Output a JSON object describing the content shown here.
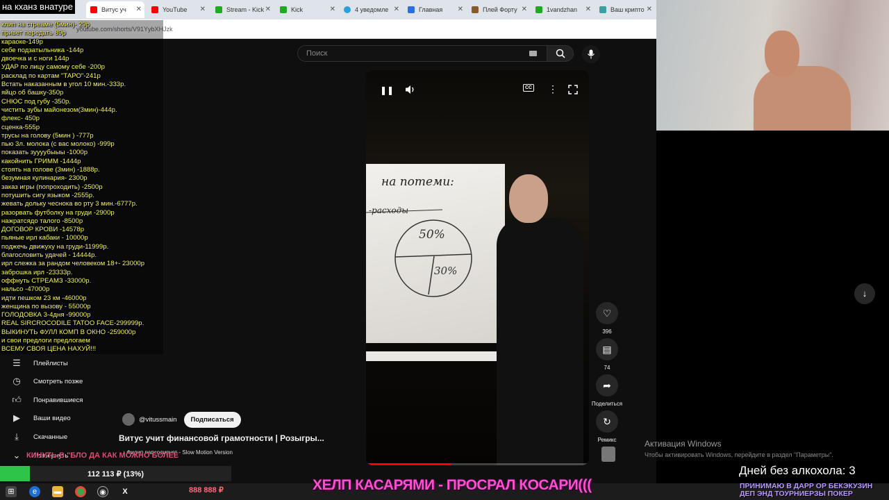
{
  "browser": {
    "tabs": [
      {
        "label": "Витус уч",
        "active": true,
        "color": "#ff0000"
      },
      {
        "label": "YouTube",
        "color": "#ff0000"
      },
      {
        "label": "Stream - Kick",
        "color": "#1faa1f"
      },
      {
        "label": "Kick",
        "color": "#1faa1f"
      },
      {
        "label": "4 уведомле",
        "color": "#2aa0e0"
      },
      {
        "label": "Главная",
        "color": "#2a6ee0"
      },
      {
        "label": "Плей Форту",
        "color": "#8a5a2a"
      },
      {
        "label": "1vandzhan",
        "color": "#1faa1f"
      },
      {
        "label": "Ваш крипто",
        "color": "#3aa0a0"
      }
    ],
    "url": "youtube.com/shorts/V91YybXHJzk"
  },
  "youtube": {
    "search_placeholder": "Поиск",
    "sidebar": [
      {
        "label": "Плейлисты",
        "icon": "playlist-icon"
      },
      {
        "label": "Смотреть позже",
        "icon": "clock-icon"
      },
      {
        "label": "Понравившиеся",
        "icon": "thumbs-up-icon"
      },
      {
        "label": "Ваши видео",
        "icon": "video-icon"
      },
      {
        "label": "Скачанные",
        "icon": "download-icon"
      },
      {
        "label": "Развернуть",
        "icon": "chevron-down-icon"
      }
    ],
    "video": {
      "board_heading": "на потеми:",
      "board_sub": "-расходы",
      "pct1": "50%",
      "pct2": "30%",
      "progress_fraction": 0.38
    },
    "actions": {
      "likes": "396",
      "comments": "74",
      "share": "Поделиться",
      "remix": "Ремикс"
    },
    "channel": "@vitussmain",
    "subscribe": "Подписаться",
    "title": "Витус учит финансовой грамотности  | Розыгры...",
    "music": "Филип рапсодирует - Slow Motion Version"
  },
  "overlay": {
    "title": "на кханз внатуре",
    "prices": [
      "клип на стреаме (5мин)- 29р",
      "привет передать 89р",
      "караоке-149р",
      "себе подзатыльника -144р",
      "двоечка и с ноги 144р",
      "УДАР по лицу самому себе -200р",
      "расклад по картам \"ТАРО\"-241р",
      "Встать наказанным в угол 10 мин.-333р.",
      "яйцо об башку-350р",
      "СНЮС под губу -350р.",
      "чистить зубы майонезом(3мин)-444р.",
      "флекс- 450р",
      "сценка-555р",
      "трусы на голову (5мин ) -777р",
      "пью 3л. молока (с вас молоко) -999р",
      "показать зуууубыыы -1000р",
      "какойнить ГРИММ -1444р",
      "стоять на голове (3мин) -1888р.",
      "безумная кулинария- 2300р",
      "заказ игры (попроходить) -2500р",
      "потушить сигу языком -2555р.",
      "жевать дольку чеснока во рту 3 мин.-6777р.",
      "разорвать футболку на груди -2900р",
      "нажратсядо талого -8500р",
      "ДОГОВОР КРОВИ -14578р",
      "пьяные ирл кабаки - 10000р",
      "поджечь движуху на груди-11999р.",
      "благословить удачей - 14444р.",
      "ирл слежка за рандом человеком 18+- 23000р",
      "заброшка ирл -23333р.",
      "оффнуть СТРЕАМЗ -33000р.",
      "нальсо -47000р",
      "идти пешком 23 км -46000р",
      "женщина по вызову - 55000р",
      "ГОЛОДОВКА 3-4дня -99000р",
      "REAL SIRCROCODILE TATOO FACE-299999р.",
      "ВЫКИНУТЬ ФУЛЛ КОМП В ОКНО -259000р",
      "и свои предлоги предлогаем",
      "ВСЕМУ СВОЯ ЦЕНА НАХУЙ!!!"
    ],
    "marquee": "КИНУТЬ В \"БЛО ДА КАК МОЖНО БОЛЕЕ",
    "donation": {
      "text": "112 113 ₽ (13%)",
      "fraction": 0.13
    },
    "money": "888 888 ₽",
    "banner": "ХЕЛП КАСАРЯМИ - ПРОСРАЛ КОСАРИ(((",
    "counter_label": "Дней без алкохола:",
    "counter_value": "3",
    "ticker": [
      "ПРИНИМАЮ В ДАРР ОР БЕКЭКУЗИН",
      "ДЕП ЭНД ТОУРНИЕРЗЫ ПОКЕР"
    ],
    "activation_title": "Активация Windows",
    "activation_text": "Чтобы активировать Windows, перейдите в раздел \"Параметры\"."
  }
}
